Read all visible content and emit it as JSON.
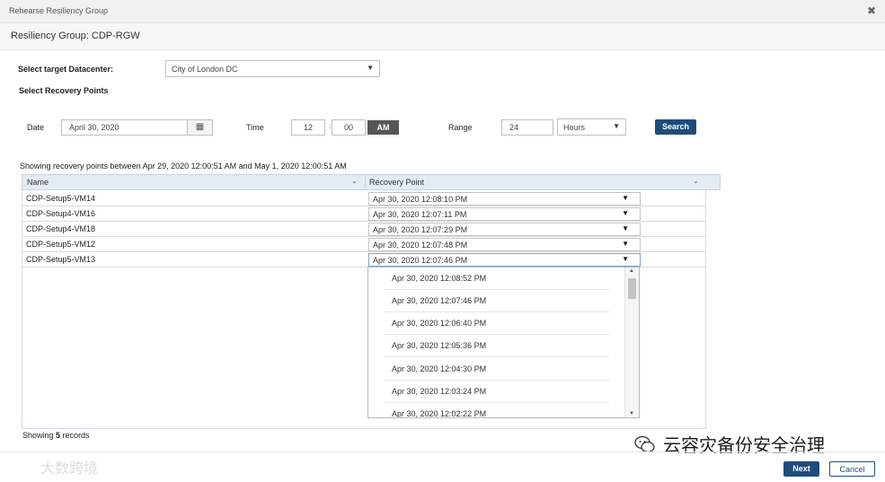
{
  "window": {
    "title": "Rehearse Resiliency Group"
  },
  "header": {
    "resiliency_group": "Resiliency Group: CDP-RGW"
  },
  "datacenter": {
    "label": "Select target Datacenter:",
    "value": "City of London DC"
  },
  "recovery_points_label": "Select Recovery Points",
  "filters": {
    "date_label": "Date",
    "date_value": "April 30, 2020",
    "time_label": "Time",
    "hour": "12",
    "minute": "00",
    "ampm": "AM",
    "range_label": "Range",
    "range_value": "24",
    "range_unit": "Hours",
    "search_label": "Search"
  },
  "summary": "Showing recovery points between Apr 29, 2020 12:00:51 AM and May 1, 2020 12:00:51 AM",
  "table": {
    "columns": [
      "Name",
      "Recovery Point"
    ],
    "rows": [
      {
        "name": "CDP-Setup5-VM14",
        "recovery_point": "Apr 30, 2020 12:08:10 PM"
      },
      {
        "name": "CDP-Setup4-VM16",
        "recovery_point": "Apr 30, 2020 12:07:11 PM"
      },
      {
        "name": "CDP-Setup4-VM18",
        "recovery_point": "Apr 30, 2020 12:07:29 PM"
      },
      {
        "name": "CDP-Setup5-VM12",
        "recovery_point": "Apr 30, 2020 12:07:48 PM"
      },
      {
        "name": "CDP-Setup5-VM13",
        "recovery_point": "Apr 30, 2020 12:07:46 PM"
      }
    ],
    "dropdown_options": [
      "Apr 30, 2020 12:08:52 PM",
      "Apr 30, 2020 12:07:46 PM",
      "Apr 30, 2020 12:06:40 PM",
      "Apr 30, 2020 12:05:36 PM",
      "Apr 30, 2020 12:04:30 PM",
      "Apr 30, 2020 12:03:24 PM",
      "Apr 30, 2020 12:02:22 PM"
    ],
    "footer_prefix": "Showing ",
    "footer_count": "5",
    "footer_suffix": " records"
  },
  "buttons": {
    "next": "Next",
    "cancel": "Cancel"
  },
  "watermarks": {
    "primary": "云容灾备份安全治理",
    "secondary": "大数跨境"
  },
  "icons": {
    "close": "close-icon",
    "calendar": "calendar-icon",
    "caret": "caret-down-icon"
  },
  "colors": {
    "primary_button": "#1f4c7d",
    "grid_header": "#e3ebf5",
    "ampm_bg": "#555555"
  }
}
